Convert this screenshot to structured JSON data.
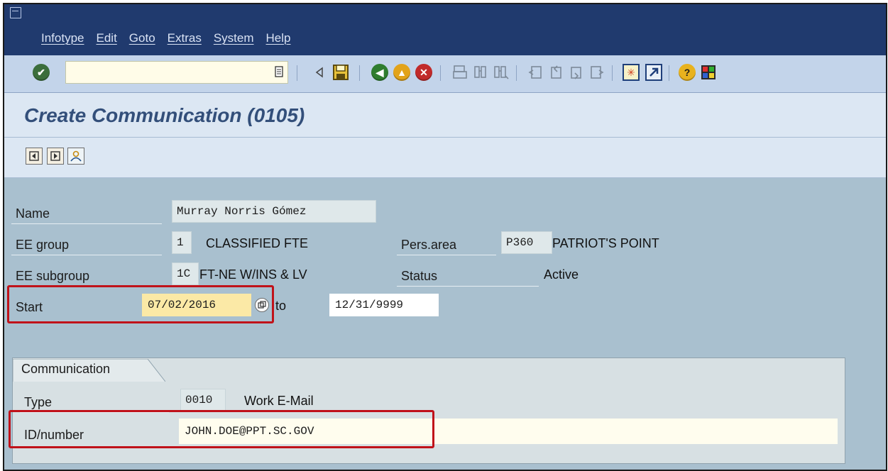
{
  "menu": {
    "items": [
      "Infotype",
      "Edit",
      "Goto",
      "Extras",
      "System",
      "Help"
    ]
  },
  "toolbar": {
    "command_value": "",
    "icons": [
      "enter-icon",
      "command-history-icon",
      "back-arrow-icon",
      "save-icon",
      "back-icon",
      "exit-icon",
      "cancel-icon",
      "print-icon",
      "find-icon",
      "find-next-icon",
      "first-page-icon",
      "previous-page-icon",
      "next-page-icon",
      "last-page-icon",
      "create-session-icon",
      "shortcut-icon",
      "help-icon",
      "customize-layout-icon"
    ]
  },
  "title": "Create Communication (0105)",
  "app_toolbar": {
    "icons": [
      "previous-record-icon",
      "next-record-icon",
      "person-icon"
    ]
  },
  "header": {
    "name_label": "Name",
    "name_value": "Murray Norris Gómez",
    "ee_group_label": "EE group",
    "ee_group_code": "1",
    "ee_group_text": "CLASSIFIED FTE",
    "pers_area_label": "Pers.area",
    "pers_area_code": "P360",
    "pers_area_text": "PATRIOT'S POINT",
    "ee_subgroup_label": "EE subgroup",
    "ee_subgroup_code": "1C",
    "ee_subgroup_text": "FT-NE W/INS & LV",
    "status_label": "Status",
    "status_value": "Active",
    "start_label": "Start",
    "start_value": "07/02/2016",
    "to_label": "to",
    "end_value": "12/31/9999"
  },
  "communication": {
    "group_title": "Communication",
    "type_label": "Type",
    "type_code": "0010",
    "type_text": "Work E-Mail",
    "id_label": "ID/number",
    "id_value": "JOHN.DOE@PPT.SC.GOV"
  },
  "colors": {
    "menu_bar": "#203a6e",
    "toolbar": "#c3d4ea",
    "form_background": "#a9c0cf",
    "highlight_box": "#c0121a",
    "title_text": "#334f7a"
  }
}
